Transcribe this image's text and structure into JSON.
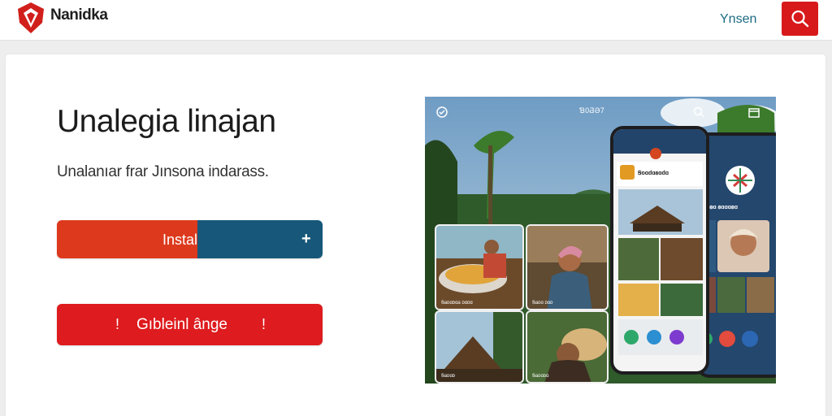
{
  "header": {
    "brand_name": "Nanidka",
    "brand_tagline": "",
    "nav_link": "Ynsen",
    "search_icon": "search-icon"
  },
  "hero": {
    "headline": "Unalegia linajan",
    "subtitle": "Unalanıar frar Jınsona indarass.",
    "install_button": {
      "label": "Instal",
      "icon": "+"
    },
    "explore_button": {
      "label": "Gıbleinl ânge",
      "mark": "!"
    }
  },
  "showcase": {
    "caption": "Ɓ0ƋƏ7",
    "tiles": [
      {
        "label": "Ꞩaᴅɑᴅɑa ᴅɑᴅɑ"
      },
      {
        "label": "Ꞩaᴅɑ ᴅɑᴅ"
      },
      {
        "label": "Ꞩaᴅɑᴅ"
      },
      {
        "label": "Ꞩaᴅɑᴅɑ"
      }
    ],
    "phone_front_title": "Ꞩoɑdɑꞩɑdɑ",
    "phone_back_title": "Ꞩɑꞩɑ ꞩɑɑɑꞩɑ"
  },
  "colors": {
    "brand_red": "#d7191b",
    "install_left": "#dd3a1d",
    "install_right": "#17587a",
    "nav_link": "#1b6a83"
  }
}
